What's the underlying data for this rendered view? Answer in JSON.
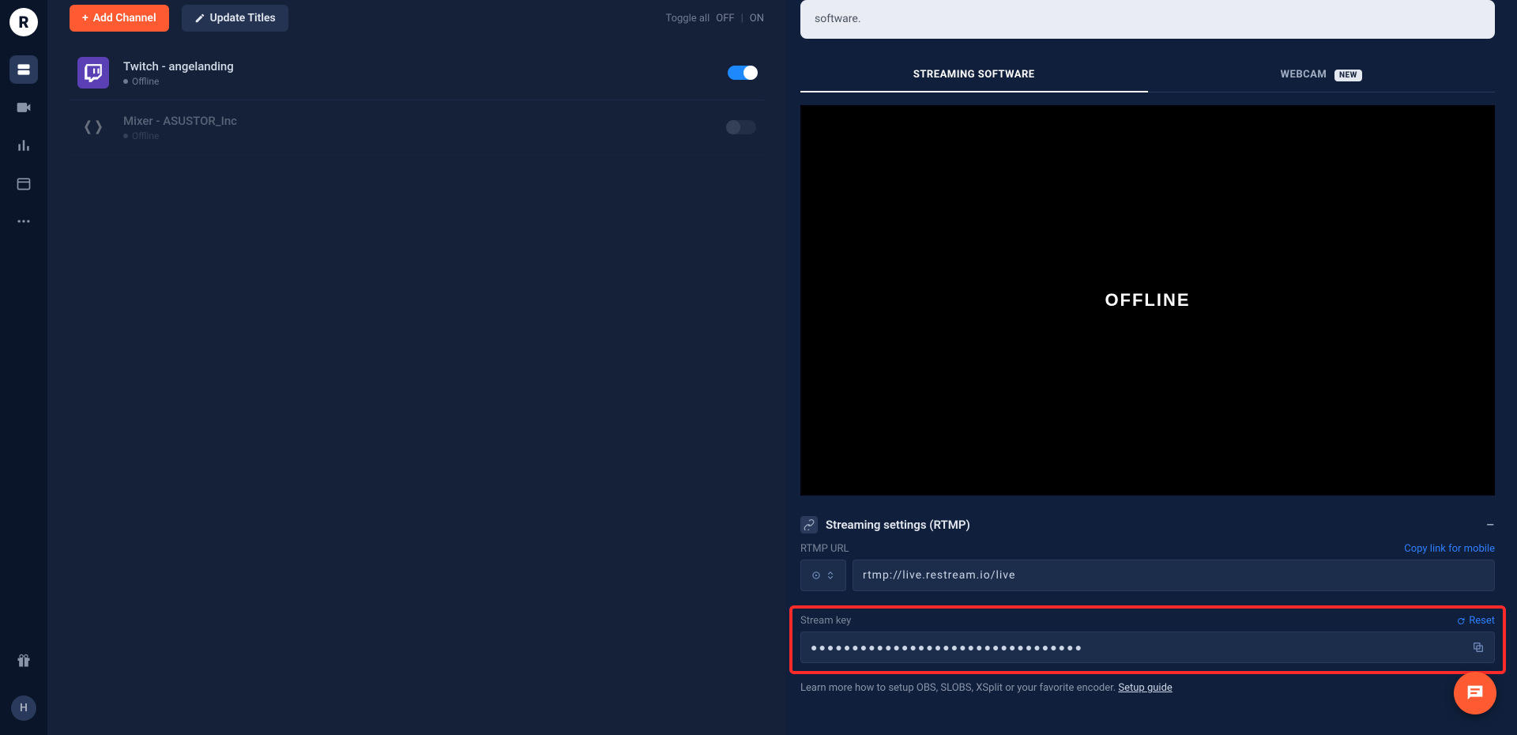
{
  "sidebar": {
    "logo_letter": "R",
    "avatar_letter": "H"
  },
  "toolbar": {
    "add_channel": "Add Channel",
    "update_titles": "Update Titles",
    "toggle_all": "Toggle all",
    "off": "OFF",
    "on": "ON"
  },
  "channels": [
    {
      "name": "Twitch - angelanding",
      "status": "Offline",
      "enabled": true,
      "provider": "twitch"
    },
    {
      "name": "Mixer - ASUSTOR_Inc",
      "status": "Offline",
      "enabled": false,
      "provider": "mixer"
    }
  ],
  "info_box": "software.",
  "tabs": {
    "software": "STREAMING SOFTWARE",
    "webcam": "WEBCAM",
    "new_badge": "NEW"
  },
  "preview": {
    "status": "OFFLINE"
  },
  "settings_header": "Streaming settings (RTMP)",
  "rtmp": {
    "label": "RTMP URL",
    "copy_link": "Copy link for mobile",
    "value": "rtmp://live.restream.io/live"
  },
  "stream_key": {
    "label": "Stream key",
    "reset": "Reset",
    "value": "●●●●●●●●●●●●●●●●●●●●●●●●●●●●●●●●●"
  },
  "footnote": {
    "text": "Learn more how to setup OBS, SLOBS, XSplit or your favorite encoder. ",
    "guide": "Setup guide"
  }
}
